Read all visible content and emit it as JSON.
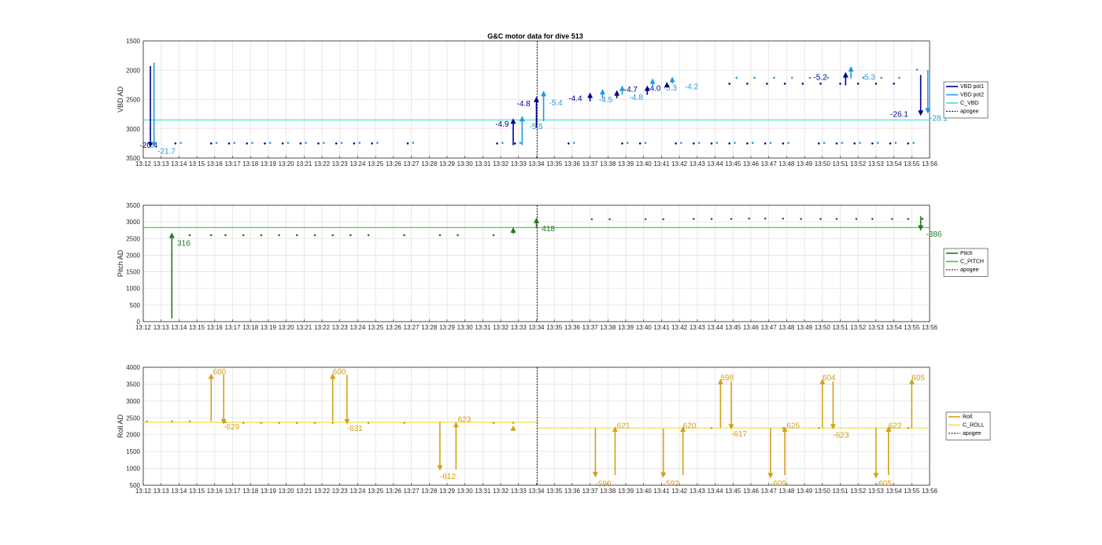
{
  "figure_title": "G&C motor data for dive 513",
  "time_ticks": [
    "13:12",
    "13:13",
    "13:14",
    "13:15",
    "13:16",
    "13:17",
    "13:18",
    "13:19",
    "13:20",
    "13:21",
    "13:22",
    "13:23",
    "13:24",
    "13:25",
    "13:26",
    "13:27",
    "13:28",
    "13:29",
    "13:30",
    "13:31",
    "13:32",
    "13:33",
    "13:34",
    "13:35",
    "13:36",
    "13:37",
    "13:38",
    "13:39",
    "13:40",
    "13:41",
    "13:42",
    "13:43",
    "13:44",
    "13:45",
    "13:46",
    "13:47",
    "13:48",
    "13:49",
    "13:50",
    "13:51",
    "13:52",
    "13:53",
    "13:54",
    "13:55",
    "13:56"
  ],
  "chart_data": [
    {
      "type": "scatter",
      "id": "vbd",
      "title": "G&C motor data for dive 513",
      "ylabel": "VBD AD",
      "xlabel": "",
      "xlim": [
        0,
        44
      ],
      "x_unit": "minutes after 13:12",
      "ylim": [
        1500,
        3500
      ],
      "y_reversed": true,
      "yticks": [
        1500,
        2000,
        2500,
        3000,
        3500
      ],
      "grid": true,
      "legend_position": "right",
      "legend": [
        {
          "name": "VBD pot1",
          "color": "#00008b"
        },
        {
          "name": "VBD pot2",
          "color": "#1e9be0"
        },
        {
          "name": "C_VBD",
          "color": "#40e0d0"
        },
        {
          "name": "apogee",
          "color": "#000000",
          "dashed": true
        }
      ],
      "apogee_x": 22.05,
      "hlines": [
        {
          "series": "C_VBD",
          "y": 2850,
          "color": "#40e0d0"
        }
      ],
      "series": [
        {
          "name": "VBD pot1",
          "color": "#00008b",
          "x": [
            1.8,
            3.8,
            4.8,
            5.8,
            6.8,
            7.8,
            8.8,
            9.8,
            10.8,
            11.8,
            12.8,
            14.8,
            19.8,
            20.8,
            23.8,
            26.8,
            27.8,
            29.8,
            30.8,
            31.8,
            32.8,
            33.8,
            34.8,
            35.8,
            37.8,
            38.8,
            39.8,
            40.8,
            41.8,
            42.8
          ],
          "y": [
            3250,
            3250,
            3250,
            3250,
            3250,
            3250,
            3250,
            3250,
            3250,
            3250,
            3250,
            3250,
            3250,
            3250,
            3250,
            3250,
            3250,
            3250,
            3250,
            3250,
            3250,
            3250,
            3250,
            3250,
            3250,
            3250,
            3250,
            3250,
            3250,
            3250
          ]
        },
        {
          "name": "VBD pot2",
          "color": "#1e9be0",
          "x": [
            2.1,
            4.1,
            5.1,
            6.1,
            7.1,
            8.1,
            9.1,
            10.1,
            11.1,
            12.1,
            13.1,
            15.1,
            20.1,
            21.1,
            24.1,
            27.1,
            28.1,
            30.1,
            31.1,
            32.1,
            33.1,
            34.1,
            35.1,
            36.1,
            38.1,
            39.1,
            40.1,
            41.1,
            42.1,
            43.1
          ],
          "y": [
            3240,
            3240,
            3240,
            3240,
            3240,
            3240,
            3240,
            3240,
            3240,
            3240,
            3240,
            3240,
            3240,
            3240,
            3240,
            3240,
            3240,
            3240,
            3240,
            3240,
            3240,
            3240,
            3240,
            3240,
            3240,
            3240,
            3240,
            3240,
            3240,
            3240
          ]
        },
        {
          "name": "VBD pot1 late",
          "color": "#00008b",
          "x": [
            32.8,
            33.8,
            34.9,
            35.9,
            36.9,
            37.9,
            39.0,
            40.0,
            41.0,
            42.0
          ],
          "y": [
            2230,
            2230,
            2230,
            2230,
            2230,
            2230,
            2230,
            2230,
            2230,
            2230
          ]
        },
        {
          "name": "VBD pot2 late",
          "color": "#1e9be0",
          "x": [
            33.2,
            34.2,
            35.3,
            36.3,
            37.3,
            38.3,
            39.3,
            40.3,
            41.3,
            42.3,
            43.3
          ],
          "y": [
            2130,
            2130,
            2130,
            2130,
            2130,
            2130,
            2130,
            2130,
            2130,
            2130,
            1990
          ]
        }
      ],
      "arrows": [
        {
          "x": 0.4,
          "from": 1930,
          "to": 3320,
          "color": "#00008b",
          "label": "-20.4",
          "lx": -0.2,
          "ly": 3270
        },
        {
          "x": 0.6,
          "from": 1870,
          "to": 3320,
          "color": "#1e9be0",
          "label": "-21.7",
          "lx": 0.8,
          "ly": 3370
        },
        {
          "x": 20.7,
          "from": 3280,
          "to": 2820,
          "color": "#00008b",
          "label": "-4.9",
          "lx": 19.7,
          "ly": 2910
        },
        {
          "x": 21.2,
          "from": 3280,
          "to": 2780,
          "color": "#1e9be0",
          "label": "-5.5",
          "lx": 21.6,
          "ly": 2950
        },
        {
          "x": 22.0,
          "from": 2980,
          "to": 2450,
          "color": "#00008b",
          "label": "-4.8",
          "lx": 20.9,
          "ly": 2560
        },
        {
          "x": 22.4,
          "from": 2870,
          "to": 2350,
          "color": "#1e9be0",
          "label": "-5.4",
          "lx": 22.7,
          "ly": 2550
        },
        {
          "x": 25.0,
          "from": 2530,
          "to": 2380,
          "color": "#00008b",
          "label": "-4.4",
          "lx": 23.8,
          "ly": 2470
        },
        {
          "x": 25.7,
          "from": 2480,
          "to": 2320,
          "color": "#1e9be0",
          "label": "-4.5",
          "lx": 25.5,
          "ly": 2490
        },
        {
          "x": 26.5,
          "from": 2480,
          "to": 2340,
          "color": "#00008b",
          "label": "-4.7",
          "lx": 26.9,
          "ly": 2320
        },
        {
          "x": 26.8,
          "from": 2420,
          "to": 2260,
          "color": "#1e9be0",
          "label": "-4.8",
          "lx": 27.2,
          "ly": 2450
        },
        {
          "x": 28.2,
          "from": 2420,
          "to": 2260,
          "color": "#00008b",
          "label": "-4.0",
          "lx": 28.2,
          "ly": 2300
        },
        {
          "x": 28.5,
          "from": 2300,
          "to": 2140,
          "color": "#1e9be0",
          "label": "-5.3",
          "lx": 29.1,
          "ly": 2290
        },
        {
          "x": 29.3,
          "from": 2280,
          "to": 2200,
          "color": "#00008b",
          "label": "",
          "lx": 0,
          "ly": 0
        },
        {
          "x": 29.6,
          "from": 2230,
          "to": 2110,
          "color": "#1e9be0",
          "label": "-4.2",
          "lx": 30.3,
          "ly": 2270
        },
        {
          "x": 39.3,
          "from": 2260,
          "to": 2030,
          "color": "#00008b",
          "label": "-5.2",
          "lx": 37.5,
          "ly": 2110
        },
        {
          "x": 39.6,
          "from": 2140,
          "to": 1930,
          "color": "#1e9be0",
          "label": "-5.3",
          "lx": 40.2,
          "ly": 2110
        },
        {
          "x": 43.5,
          "from": 2080,
          "to": 2780,
          "color": "#00008b",
          "label": "-26.1",
          "lx": 41.8,
          "ly": 2740
        },
        {
          "x": 43.9,
          "from": 2000,
          "to": 2740,
          "color": "#1e9be0",
          "label": "-28.1",
          "lx": 44.0,
          "ly": 2810
        }
      ]
    },
    {
      "type": "scatter",
      "id": "pitch",
      "ylabel": "Pitch AD",
      "xlabel": "",
      "xlim": [
        0,
        44
      ],
      "ylim": [
        0,
        3500
      ],
      "yticks": [
        0,
        500,
        1000,
        1500,
        2000,
        2500,
        3000,
        3500
      ],
      "grid": true,
      "legend_position": "right",
      "legend": [
        {
          "name": "Pitch",
          "color": "#1f7a1f"
        },
        {
          "name": "C_PITCH",
          "color": "#33cc33"
        },
        {
          "name": "apogee",
          "color": "#000000",
          "dashed": true
        }
      ],
      "apogee_x": 22.05,
      "hlines": [
        {
          "series": "C_PITCH",
          "y": 2830,
          "color": "#33cc33"
        }
      ],
      "series": [
        {
          "name": "Pitch",
          "color": "#1f7a1f",
          "x": [
            2.6,
            3.8,
            4.6,
            5.6,
            6.6,
            7.6,
            8.6,
            9.6,
            10.6,
            11.6,
            12.6,
            14.6,
            16.6,
            17.6,
            19.6,
            25.1,
            26.1,
            28.1,
            29.1,
            30.8,
            31.8,
            32.9,
            33.9,
            34.8,
            35.8,
            36.8,
            37.9,
            38.8,
            39.9,
            40.8,
            41.9,
            42.8,
            43.6
          ],
          "y": [
            2600,
            2600,
            2600,
            2600,
            2600,
            2600,
            2600,
            2600,
            2600,
            2600,
            2600,
            2600,
            2600,
            2600,
            2600,
            3080,
            3080,
            3080,
            3080,
            3090,
            3090,
            3090,
            3100,
            3100,
            3100,
            3090,
            3090,
            3090,
            3090,
            3090,
            3090,
            3090,
            3090
          ]
        }
      ],
      "arrows": [
        {
          "x": 1.6,
          "from": 100,
          "to": 2680,
          "color": "#1f7a1f",
          "label": "316",
          "lx": 1.9,
          "ly": 2380
        },
        {
          "x": 20.7,
          "from": 2640,
          "to": 2840,
          "color": "#1f7a1f",
          "label": "",
          "lx": 0,
          "ly": 0
        },
        {
          "x": 22.0,
          "from": 2820,
          "to": 3130,
          "color": "#1f7a1f",
          "label": "418",
          "lx": 22.3,
          "ly": 2820
        },
        {
          "x": 43.5,
          "from": 3170,
          "to": 2730,
          "color": "#1f7a1f",
          "label": "-386",
          "lx": 43.8,
          "ly": 2650
        }
      ]
    },
    {
      "type": "scatter",
      "id": "roll",
      "ylabel": "Roll AD",
      "xlabel": "",
      "xlim": [
        0,
        44
      ],
      "ylim": [
        500,
        4000
      ],
      "yticks": [
        500,
        1000,
        1500,
        2000,
        2500,
        3000,
        3500,
        4000
      ],
      "grid": true,
      "legend_position": "right",
      "legend": [
        {
          "name": "Roll",
          "color": "#d4a017"
        },
        {
          "name": "C_ROLL",
          "color": "#f0e040"
        },
        {
          "name": "apogee",
          "color": "#000000",
          "dashed": true
        }
      ],
      "apogee_x": 22.05,
      "hlines": [
        {
          "series": "C_ROLL",
          "y": 2370,
          "x0": 0,
          "x1": 22.05,
          "color": "#f0e040"
        },
        {
          "series": "C_ROLL",
          "y": 2200,
          "x0": 22.05,
          "x1": 44,
          "color": "#f0e040"
        }
      ],
      "series": [
        {
          "name": "Roll",
          "color": "#d4a017",
          "x": [
            0.2,
            1.6,
            2.6,
            4.6,
            5.6,
            6.6,
            7.6,
            8.6,
            9.6,
            10.6,
            12.6,
            14.6,
            19.6,
            20.7,
            31.8,
            35.8,
            37.8,
            41.8,
            42.8
          ],
          "y": [
            2400,
            2400,
            2400,
            2370,
            2350,
            2350,
            2350,
            2350,
            2350,
            2350,
            2350,
            2350,
            2350,
            2350,
            2200,
            2200,
            2200,
            2200,
            2200
          ]
        }
      ],
      "arrows": [
        {
          "x": 3.8,
          "from": 2400,
          "to": 3820,
          "color": "#d4a017",
          "label": "600",
          "lx": 3.9,
          "ly": 3880
        },
        {
          "x": 4.5,
          "from": 3780,
          "to": 2300,
          "color": "#d4a017",
          "label": "-629",
          "lx": 4.5,
          "ly": 2250
        },
        {
          "x": 10.6,
          "from": 2400,
          "to": 3820,
          "color": "#d4a017",
          "label": "600",
          "lx": 10.6,
          "ly": 3880
        },
        {
          "x": 11.4,
          "from": 3780,
          "to": 2300,
          "color": "#d4a017",
          "label": "-631",
          "lx": 11.4,
          "ly": 2200
        },
        {
          "x": 16.6,
          "from": 2380,
          "to": 930,
          "color": "#d4a017",
          "label": "-612",
          "lx": 16.6,
          "ly": 780
        },
        {
          "x": 17.5,
          "from": 960,
          "to": 2380,
          "color": "#d4a017",
          "label": "623",
          "lx": 17.6,
          "ly": 2470
        },
        {
          "x": 20.7,
          "from": 2150,
          "to": 2280,
          "color": "#d4a017",
          "label": "",
          "lx": 0,
          "ly": 0
        },
        {
          "x": 25.3,
          "from": 2200,
          "to": 730,
          "color": "#d4a017",
          "label": "-590",
          "lx": 25.3,
          "ly": 560
        },
        {
          "x": 26.4,
          "from": 800,
          "to": 2250,
          "color": "#d4a017",
          "label": "621",
          "lx": 26.5,
          "ly": 2280
        },
        {
          "x": 29.1,
          "from": 2180,
          "to": 720,
          "color": "#d4a017",
          "label": "-592",
          "lx": 29.1,
          "ly": 570
        },
        {
          "x": 30.2,
          "from": 800,
          "to": 2250,
          "color": "#d4a017",
          "label": "620",
          "lx": 30.2,
          "ly": 2280
        },
        {
          "x": 32.3,
          "from": 2200,
          "to": 3660,
          "color": "#d4a017",
          "label": "598",
          "lx": 32.3,
          "ly": 3710
        },
        {
          "x": 32.9,
          "from": 3580,
          "to": 2150,
          "color": "#d4a017",
          "label": "-617",
          "lx": 32.9,
          "ly": 2040
        },
        {
          "x": 35.1,
          "from": 2200,
          "to": 700,
          "color": "#d4a017",
          "label": "-609",
          "lx": 35.1,
          "ly": 570
        },
        {
          "x": 35.9,
          "from": 800,
          "to": 2250,
          "color": "#d4a017",
          "label": "625",
          "lx": 36.0,
          "ly": 2280
        },
        {
          "x": 38.0,
          "from": 2200,
          "to": 3660,
          "color": "#d4a017",
          "label": "604",
          "lx": 38.0,
          "ly": 3710
        },
        {
          "x": 38.6,
          "from": 3580,
          "to": 2150,
          "color": "#d4a017",
          "label": "-623",
          "lx": 38.6,
          "ly": 2000
        },
        {
          "x": 41.0,
          "from": 2200,
          "to": 700,
          "color": "#d4a017",
          "label": "-605",
          "lx": 41.0,
          "ly": 570
        },
        {
          "x": 41.7,
          "from": 800,
          "to": 2250,
          "color": "#d4a017",
          "label": "622",
          "lx": 41.7,
          "ly": 2280
        },
        {
          "x": 43.0,
          "from": 2200,
          "to": 3660,
          "color": "#d4a017",
          "label": "605",
          "lx": 43.0,
          "ly": 3710
        }
      ]
    }
  ]
}
